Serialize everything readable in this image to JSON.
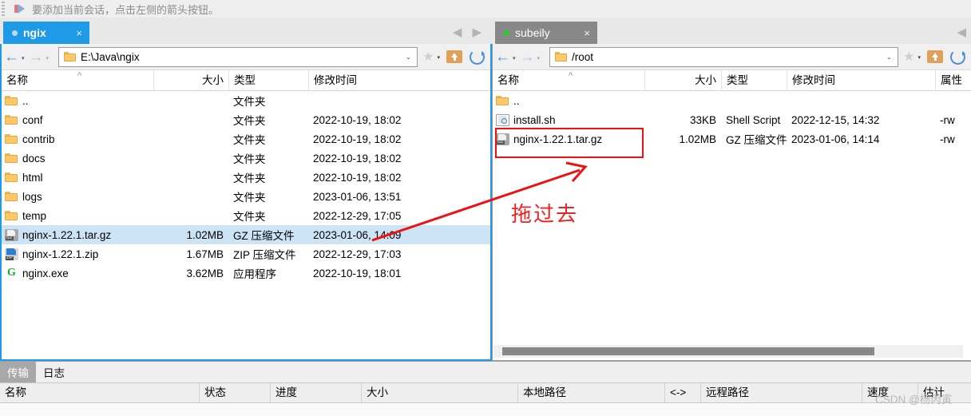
{
  "notice": {
    "text": "要添加当前会话，点击左侧的箭头按钮。",
    "icon": "arrow-right-icon"
  },
  "left_panel": {
    "tab": {
      "label": "ngix",
      "close": "×",
      "status_dot": "gray"
    },
    "nav": {
      "back": "←",
      "forward": "→",
      "back_caret": "▾",
      "forward_caret": "▾"
    },
    "address": {
      "value": "E:\\Java\\ngix",
      "dropdown_caret": "⌄",
      "folder_icon": "folder-icon"
    },
    "toolbar": {
      "star": "★",
      "star_caret": "▾",
      "upload_icon": "upload-folder-icon",
      "refresh_icon": "refresh-icon"
    },
    "columns": [
      "名称",
      "大小",
      "类型",
      "修改时间"
    ],
    "sort_mark": "^",
    "rows": [
      {
        "name": "..",
        "icon": "folder-icon",
        "size": "",
        "type": "文件夹",
        "modified": "",
        "selected": false
      },
      {
        "name": "conf",
        "icon": "folder-icon",
        "size": "",
        "type": "文件夹",
        "modified": "2022-10-19, 18:02",
        "selected": false
      },
      {
        "name": "contrib",
        "icon": "folder-icon",
        "size": "",
        "type": "文件夹",
        "modified": "2022-10-19, 18:02",
        "selected": false
      },
      {
        "name": "docs",
        "icon": "folder-icon",
        "size": "",
        "type": "文件夹",
        "modified": "2022-10-19, 18:02",
        "selected": false
      },
      {
        "name": "html",
        "icon": "folder-icon",
        "size": "",
        "type": "文件夹",
        "modified": "2022-10-19, 18:02",
        "selected": false
      },
      {
        "name": "logs",
        "icon": "folder-icon",
        "size": "",
        "type": "文件夹",
        "modified": "2023-01-06, 13:51",
        "selected": false
      },
      {
        "name": "temp",
        "icon": "folder-icon",
        "size": "",
        "type": "文件夹",
        "modified": "2022-12-29, 17:05",
        "selected": false
      },
      {
        "name": "nginx-1.22.1.tar.gz",
        "icon": "gz-archive-icon",
        "size": "1.02MB",
        "type": "GZ 压缩文件",
        "modified": "2023-01-06, 14:09",
        "selected": true
      },
      {
        "name": "nginx-1.22.1.zip",
        "icon": "zip-archive-icon",
        "size": "1.67MB",
        "type": "ZIP 压缩文件",
        "modified": "2022-12-29, 17:03",
        "selected": false
      },
      {
        "name": "nginx.exe",
        "icon": "exe-icon",
        "size": "3.62MB",
        "type": "应用程序",
        "modified": "2022-10-19, 18:01",
        "selected": false
      }
    ]
  },
  "right_panel": {
    "tab": {
      "label": "subeily",
      "close": "×",
      "status_dot": "green"
    },
    "nav": {
      "back": "←",
      "forward": "→",
      "back_caret": "▾",
      "forward_caret": "▾"
    },
    "address": {
      "value": "/root",
      "dropdown_caret": "⌄",
      "folder_icon": "folder-icon"
    },
    "toolbar": {
      "star": "★",
      "star_caret": "▾",
      "upload_icon": "upload-folder-icon",
      "refresh_icon": "refresh-icon"
    },
    "columns": [
      "名称",
      "大小",
      "类型",
      "修改时间",
      "属性"
    ],
    "sort_mark": "^",
    "rows": [
      {
        "name": "..",
        "icon": "folder-icon",
        "size": "",
        "type": "",
        "modified": "",
        "attrs": "",
        "boxed": false
      },
      {
        "name": "install.sh",
        "icon": "shell-script-icon",
        "size": "33KB",
        "type": "Shell Script",
        "modified": "2022-12-15, 14:32",
        "attrs": "-rw",
        "boxed": false
      },
      {
        "name": "nginx-1.22.1.tar.gz",
        "icon": "gz-archive-icon",
        "size": "1.02MB",
        "type": "GZ 压缩文件",
        "modified": "2023-01-06, 14:14",
        "attrs": "-rw",
        "boxed": true
      }
    ]
  },
  "annotation": {
    "drag_label": "拖过去",
    "arrow_color": "#ee1111",
    "box_color": "#ee1111"
  },
  "bottom_panel": {
    "tabs": [
      {
        "label": "传输",
        "active": true
      },
      {
        "label": "日志",
        "active": false
      }
    ],
    "columns": [
      "名称",
      "状态",
      "进度",
      "大小",
      "本地路径",
      "<->",
      "远程路径",
      "速度",
      "估计"
    ]
  },
  "watermark": {
    "text": "CSDN @杨丙寅"
  }
}
